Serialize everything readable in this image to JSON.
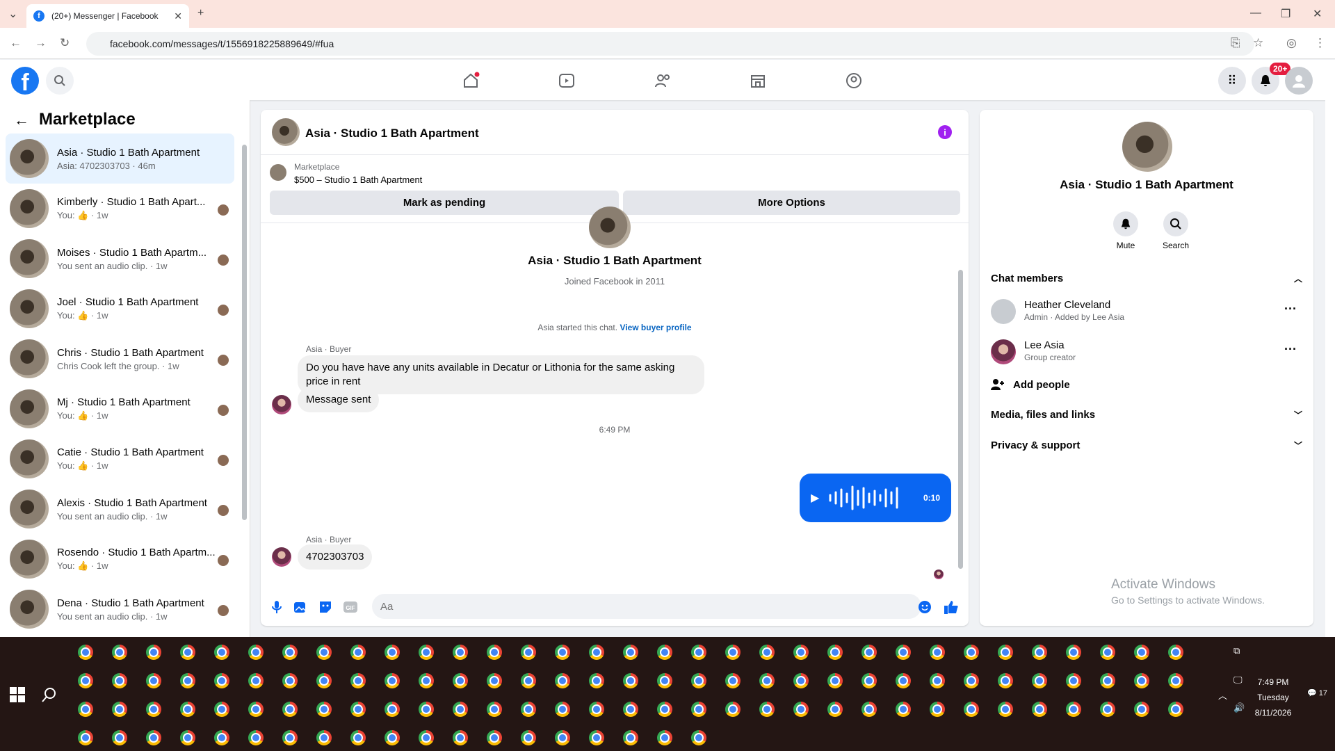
{
  "browser": {
    "tab_title": "(20+) Messenger | Facebook",
    "url": "facebook.com/messages/t/1556918225889649/#fua"
  },
  "fb": {
    "notif_count": "20+"
  },
  "left": {
    "title": "Marketplace",
    "conversations": [
      {
        "name": "Asia · Studio 1 Bath Apartment",
        "sub": "Asia: 4702303703 · 46m",
        "active": true
      },
      {
        "name": "Kimberly · Studio 1 Bath Apart...",
        "sub": "You: 👍 · 1w"
      },
      {
        "name": "Moises · Studio 1 Bath Apartm...",
        "sub": "You sent an audio clip. · 1w"
      },
      {
        "name": "Joel · Studio 1 Bath Apartment",
        "sub": "You: 👍 · 1w"
      },
      {
        "name": "Chris · Studio 1 Bath Apartment",
        "sub": "Chris Cook left the group. · 1w"
      },
      {
        "name": "Mj · Studio 1 Bath Apartment",
        "sub": "You: 👍 · 1w"
      },
      {
        "name": "Catie · Studio 1 Bath Apartment",
        "sub": "You: 👍 · 1w"
      },
      {
        "name": "Alexis · Studio 1 Bath Apartment",
        "sub": "You sent an audio clip. · 1w"
      },
      {
        "name": "Rosendo · Studio 1 Bath Apartm...",
        "sub": "You: 👍 · 1w"
      },
      {
        "name": "Dena · Studio 1 Bath Apartment",
        "sub": "You sent an audio clip. · 1w"
      }
    ]
  },
  "chat": {
    "title": "Asia · Studio 1 Bath Apartment",
    "marketplace_label": "Marketplace",
    "listing": "$500 – Studio 1 Bath Apartment",
    "mark_pending": "Mark as pending",
    "more_options": "More Options",
    "profile_name": "Asia · Studio 1 Bath Apartment",
    "joined": "Joined Facebook in 2011",
    "started": "Asia started this chat.",
    "view_buyer": "View buyer profile",
    "sender1": "Asia · Buyer",
    "msg1": "Do you have have any units available in Decatur or Lithonia for the same asking price in rent",
    "msg2": "Message sent",
    "time": "6:49 PM",
    "audio_duration": "0:10",
    "sender2": "Asia · Buyer",
    "msg3": "4702303703",
    "input_placeholder": "Aa"
  },
  "right": {
    "title": "Asia · Studio 1 Bath Apartment",
    "mute": "Mute",
    "search": "Search",
    "chat_members": "Chat members",
    "members": [
      {
        "name": "Heather Cleveland",
        "sub": "Admin · Added by Lee Asia"
      },
      {
        "name": "Lee Asia",
        "sub": "Group creator"
      }
    ],
    "add_people": "Add people",
    "media": "Media, files and links",
    "privacy": "Privacy & support"
  },
  "watermark": {
    "line1": "Activate Windows",
    "line2": "Go to Settings to activate Windows."
  },
  "taskbar": {
    "time": "7:49 PM",
    "day": "Tuesday",
    "date": "8/11/2026",
    "notif": "17"
  },
  "colors": {
    "fb_blue": "#1877f2",
    "active_bg": "#e7f3ff",
    "audio_blue": "#0a66f2"
  }
}
